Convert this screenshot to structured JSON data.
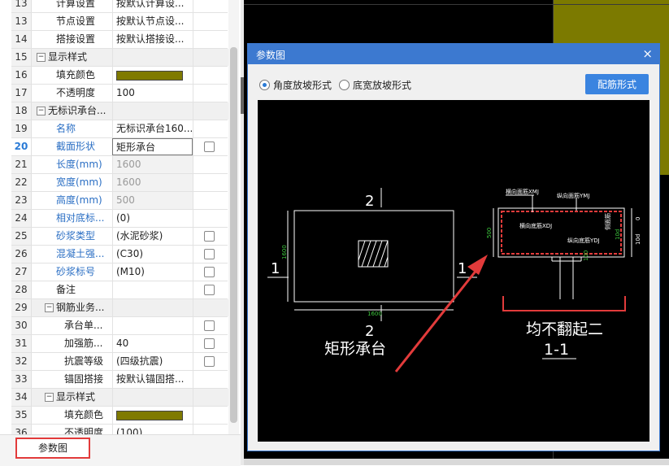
{
  "property_rows": [
    {
      "num": "13",
      "name": "计算设置",
      "value": "按默认计算设...",
      "level": 2,
      "checkbox": false,
      "partial": true
    },
    {
      "num": "13",
      "name": "节点设置",
      "value": "按默认节点设...",
      "level": 2,
      "checkbox": false
    },
    {
      "num": "14",
      "name": "搭接设置",
      "value": "按默认搭接设...",
      "level": 2,
      "checkbox": false
    },
    {
      "num": "15",
      "name": "显示样式",
      "value": "",
      "level": 0,
      "group": true,
      "expander": "−"
    },
    {
      "num": "16",
      "name": "填充颜色",
      "value": "",
      "swatch": "#7f7a00",
      "level": 2,
      "checkbox": false
    },
    {
      "num": "17",
      "name": "不透明度",
      "value": "100",
      "level": 2,
      "checkbox": false
    },
    {
      "num": "18",
      "name": "无标识承台...",
      "value": "",
      "level": 0,
      "group": true,
      "expander": "−"
    },
    {
      "num": "19",
      "name": "名称",
      "value": "无标识承台160...",
      "level": 2,
      "blue": true
    },
    {
      "num": "20",
      "name": "截面形状",
      "value": "矩形承台",
      "level": 2,
      "blue": true,
      "selected": true,
      "checkbox": true
    },
    {
      "num": "21",
      "name": "长度(mm)",
      "value": "1600",
      "level": 2,
      "blue": true,
      "gray": true
    },
    {
      "num": "22",
      "name": "宽度(mm)",
      "value": "1600",
      "level": 2,
      "blue": true,
      "gray": true
    },
    {
      "num": "23",
      "name": "高度(mm)",
      "value": "500",
      "level": 2,
      "blue": true,
      "gray": true
    },
    {
      "num": "24",
      "name": "相对底标...",
      "value": "(0)",
      "level": 2,
      "blue": true
    },
    {
      "num": "25",
      "name": "砂浆类型",
      "value": "(水泥砂浆)",
      "level": 2,
      "blue": true,
      "checkbox": true
    },
    {
      "num": "26",
      "name": "混凝土强...",
      "value": "(C30)",
      "level": 2,
      "blue": true,
      "checkbox": true
    },
    {
      "num": "27",
      "name": "砂浆标号",
      "value": "(M10)",
      "level": 2,
      "blue": true,
      "checkbox": true
    },
    {
      "num": "28",
      "name": "备注",
      "value": "",
      "level": 2,
      "checkbox": true
    },
    {
      "num": "29",
      "name": "钢筋业务...",
      "value": "",
      "level": 1,
      "group": true,
      "expander": "−"
    },
    {
      "num": "30",
      "name": "承台单...",
      "value": "",
      "level": 3,
      "checkbox": true
    },
    {
      "num": "31",
      "name": "加强筋...",
      "value": "40",
      "level": 3,
      "checkbox": true
    },
    {
      "num": "32",
      "name": "抗震等级",
      "value": "(四级抗震)",
      "level": 3,
      "checkbox": true
    },
    {
      "num": "33",
      "name": "锚固搭接",
      "value": "按默认锚固搭...",
      "level": 3,
      "checkbox": false
    },
    {
      "num": "34",
      "name": "显示样式",
      "value": "",
      "level": 1,
      "group": true,
      "expander": "−"
    },
    {
      "num": "35",
      "name": "填充颜色",
      "value": "",
      "swatch": "#7f7a00",
      "level": 3,
      "checkbox": false
    },
    {
      "num": "36",
      "name": "不透明度",
      "value": "(100)",
      "level": 3,
      "checkbox": false
    }
  ],
  "bottom_tab": {
    "label": "参数图"
  },
  "dialog": {
    "title": "参数图",
    "close_glyph": "×",
    "radio_options": [
      {
        "label": "角度放坡形式",
        "selected": true
      },
      {
        "label": "底宽放坡形式",
        "selected": false
      }
    ],
    "rebar_button": "配筋形式"
  },
  "drawing": {
    "plan_dim_width": "1600",
    "plan_dim_height": "1600",
    "section_mark_top": "2",
    "section_mark_bottom": "2",
    "section_mark_left": "1",
    "section_mark_right": "1",
    "shape_label": "矩形承台",
    "section_height": "500",
    "rebar_top_transverse": "横向面筋XMJ",
    "rebar_top_longitudinal": "纵向面筋YMJ",
    "rebar_bottom_transverse": "横向底筋XDJ",
    "rebar_bottom_longitudinal": "纵向底筋YDJ",
    "side_label": "侧面筋",
    "dim_zero": "0",
    "dim_d": "10d",
    "dim_hook": "10d",
    "dim_side": "100",
    "note": "均不翻起二",
    "section_title": "1-1"
  },
  "colors": {
    "accent": "#3c79d0",
    "olive": "#7f7a00",
    "red": "#e23b3b",
    "cad_green": "#3cc43c"
  }
}
